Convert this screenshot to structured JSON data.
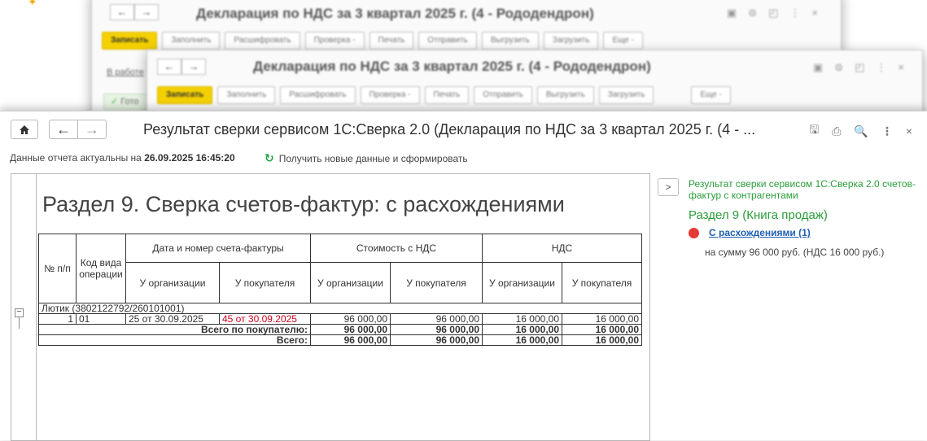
{
  "background_windows": [
    {
      "title": "Декларация по НДС за 3 квартал 2025 г. (4 - Рододендрон)",
      "buttons": [
        "Записать",
        "Заполнить",
        "Расшифровать",
        "Проверка -",
        "Печать",
        "Отправить",
        "Выгрузить",
        "Загрузить",
        "Еще -"
      ],
      "side_texts": [
        "В работе",
        "Гото"
      ]
    },
    {
      "title": "Декларация по НДС за 3 квартал 2025 г. (4 - Рододендрон)",
      "buttons": [
        "Записать",
        "Заполнить",
        "Расшифровать",
        "Проверка -",
        "Печать",
        "Отправить",
        "Выгрузить",
        "Загрузить",
        "Еще -"
      ]
    }
  ],
  "window": {
    "title": "Результат сверки сервисом 1С:Сверка 2.0 (Декларация по НДС за 3 квартал 2025 г. (4 - ...",
    "icons": [
      "save-icon",
      "print-icon",
      "preview-icon",
      "more-icon",
      "close-icon"
    ]
  },
  "freshness": {
    "prefix": "Данные отчета актуальны на",
    "datetime": "26.09.2025 16:45:20",
    "refresh_label": "Получить новые данные и сформировать"
  },
  "report": {
    "heading": "Раздел 9. Сверка счетов-фактур: с расхождениями",
    "headers": {
      "num": "№ п/п",
      "code": "Код вида операции",
      "invoice": "Дата и номер счета-фактуры",
      "cost": "Стоимость с НДС",
      "vat": "НДС",
      "org": "У организации",
      "buyer": "У покупателя"
    },
    "group_label": "Лютик (3802122792/260101001)",
    "rows": [
      {
        "num": "1",
        "code": "01",
        "inv_org": "25 от 30.09.2025",
        "inv_buyer": "45 от 30.09.2025",
        "cost_org": "96 000,00",
        "cost_buyer": "96 000,00",
        "vat_org": "16 000,00",
        "vat_buyer": "16 000,00"
      }
    ],
    "subtotal": {
      "label": "Всего по покупателю:",
      "cost_org": "96 000,00",
      "cost_buyer": "96 000,00",
      "vat_org": "16 000,00",
      "vat_buyer": "16 000,00"
    },
    "total": {
      "label": "Всего:",
      "cost_org": "96 000,00",
      "cost_buyer": "96 000,00",
      "vat_org": "16 000,00",
      "vat_buyer": "16 000,00"
    }
  },
  "panel": {
    "title": "Результат сверки сервисом 1С:Сверка 2.0 счетов-фактур с контрагентами",
    "section": "Раздел 9 (Книга продаж)",
    "item_label": "С расхождениями (1)",
    "sum_text": "на сумму 96 000 руб. (НДС 16 000 руб.)"
  },
  "colors": {
    "accent_green": "#2a9d3a",
    "link_blue": "#1e5fb4",
    "status_red": "#e53935",
    "mismatch_red": "#d0021b",
    "primary_yellow": "#f5d000"
  }
}
